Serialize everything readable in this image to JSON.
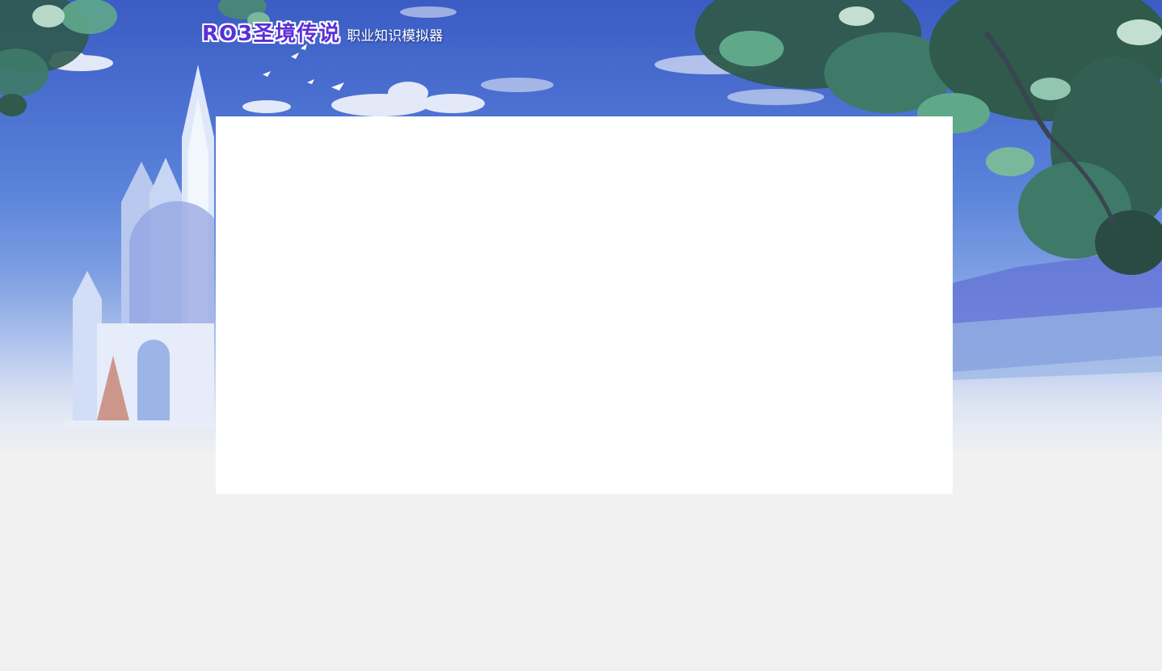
{
  "header": {
    "logo_text": "RO3圣境传说",
    "subtitle": "职业知识模拟器"
  },
  "colors": {
    "sky_top": "#3a5cc4",
    "sky_mid": "#5b84da",
    "ground": "#f1f1f1",
    "panel": "#ffffff",
    "logo_text": "#5a2fd8",
    "leaf_dark": "#2f5a4c",
    "leaf_light": "#5fa88a"
  },
  "main": {
    "content_panel": {
      "content": ""
    }
  }
}
